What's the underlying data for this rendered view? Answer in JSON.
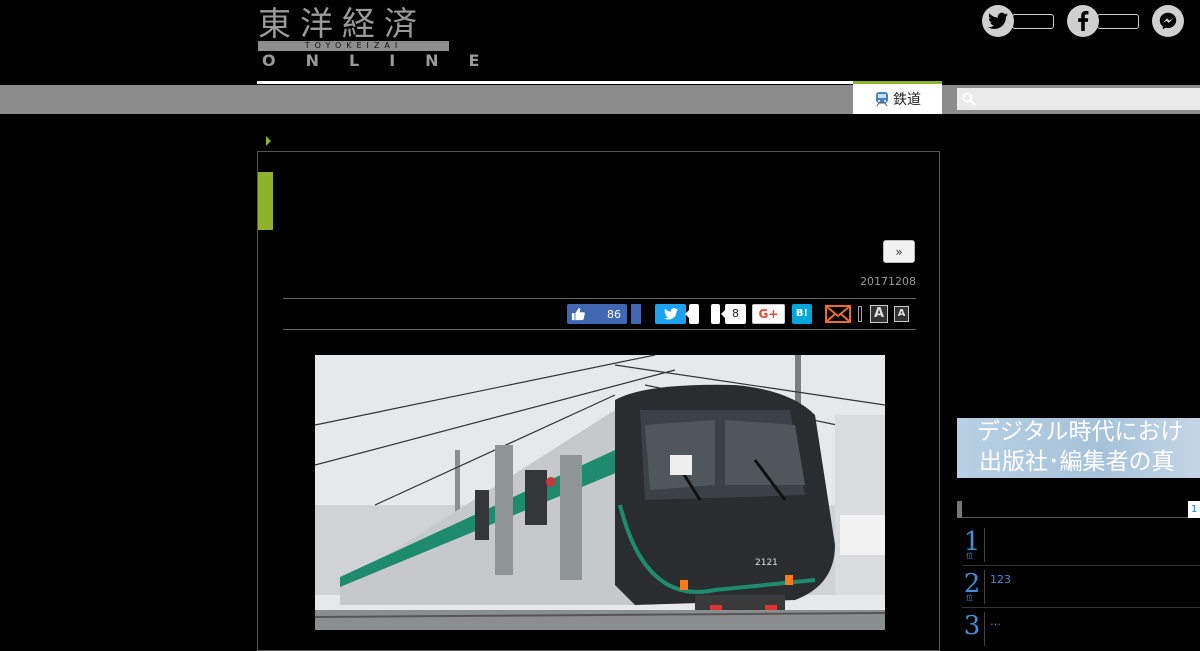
{
  "header": {
    "logo_kanji": "東洋経済",
    "logo_romaji": "TOYOKEIZAI",
    "logo_online": "ONLINE"
  },
  "social": {
    "twitter_icon": "twitter-bird-icon",
    "facebook_icon": "facebook-f-icon",
    "messenger_icon": "messenger-icon"
  },
  "nav": {
    "active_tab_label": "鉄道",
    "search_placeholder": "",
    "accent_color": "#8db32c"
  },
  "article": {
    "next_button_label": "»",
    "date": "20171208",
    "share": {
      "facebook_like_count": "86",
      "hatena_count": "8",
      "gplus_label": "G+",
      "hatena_label": "B!",
      "font_large_label": "A",
      "font_small_label": "A"
    },
    "photo": {
      "train_number": "2121"
    }
  },
  "sidebar": {
    "ad_line1": "デジタル時代におけ",
    "ad_line2": "出版社･編集者の真",
    "ranking_tab": "1",
    "ranking": [
      {
        "rank": "1",
        "sub": "位",
        "text": ""
      },
      {
        "rank": "2",
        "sub": "位",
        "text": "123"
      },
      {
        "rank": "3",
        "sub": "",
        "text": "…"
      }
    ]
  }
}
